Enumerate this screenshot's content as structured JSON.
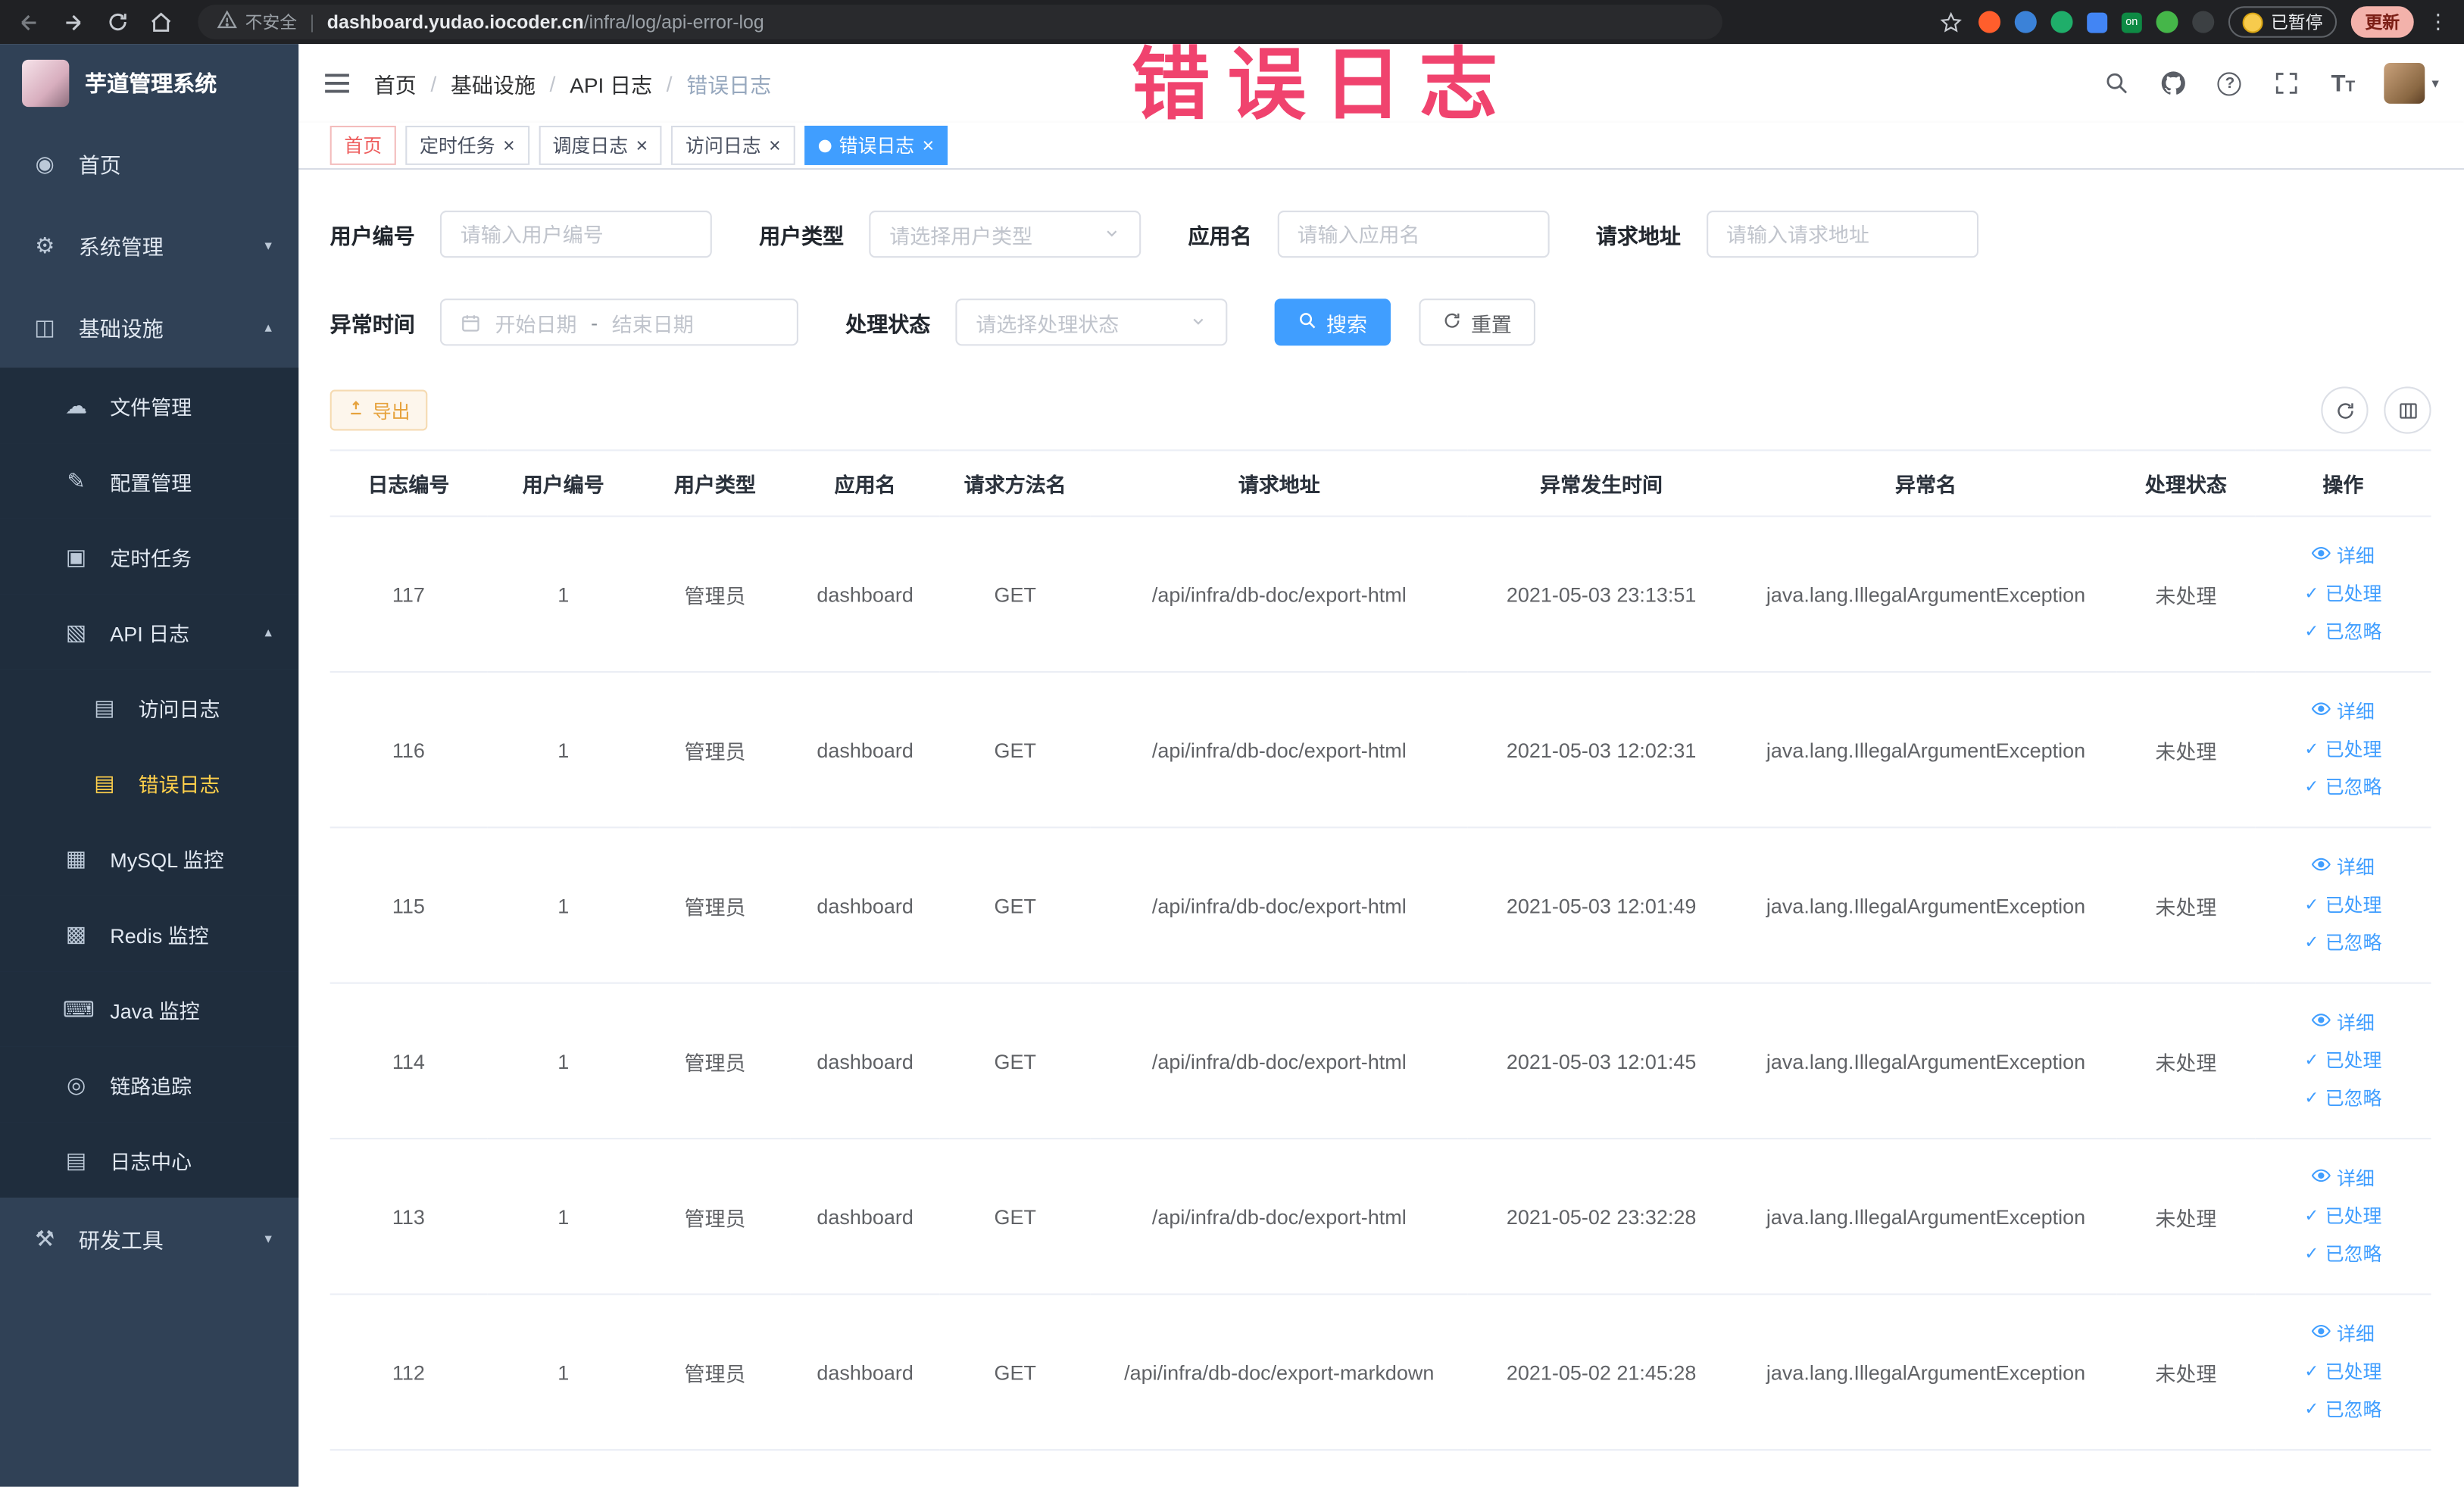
{
  "colors": {
    "accent": "#409eff",
    "sidebar_bg": "#304156",
    "submenu_bg": "#1f2d3d",
    "menu_active": "#ffd04b",
    "warning": "#e6a23c",
    "annotation": "#f0436e",
    "tag_home": "#ee5d5d"
  },
  "annotation": {
    "text": "错误日志"
  },
  "browser": {
    "security_label": "不安全",
    "url_domain": "dashboard.yudao.iocoder.cn",
    "url_path": "/infra/log/api-error-log",
    "on_badge": "on",
    "paused_label": "已暂停",
    "update_label": "更新"
  },
  "sidebar": {
    "logo_title": "芋道管理系统",
    "items": [
      {
        "name": "home",
        "label": "首页",
        "icon": "dashboard-icon",
        "glyph": "◉",
        "level": 1
      },
      {
        "name": "system-management",
        "label": "系统管理",
        "icon": "gear-icon",
        "glyph": "⚙",
        "level": 1,
        "expandable": true,
        "expanded": false
      },
      {
        "name": "infrastructure",
        "label": "基础设施",
        "icon": "component-icon",
        "glyph": "◫",
        "level": 1,
        "expandable": true,
        "expanded": true
      },
      {
        "name": "file-management",
        "label": "文件管理",
        "icon": "cloud-icon",
        "glyph": "☁",
        "level": 2
      },
      {
        "name": "config-management",
        "label": "配置管理",
        "icon": "edit-icon",
        "glyph": "✎",
        "level": 2
      },
      {
        "name": "scheduled-tasks",
        "label": "定时任务",
        "icon": "task-icon",
        "glyph": "▣",
        "level": 2
      },
      {
        "name": "api-logs",
        "label": "API 日志",
        "icon": "log-icon",
        "glyph": "▧",
        "level": 2,
        "expandable": true,
        "expanded": true
      },
      {
        "name": "access-log",
        "label": "访问日志",
        "icon": "document-icon",
        "glyph": "▤",
        "level": 3
      },
      {
        "name": "error-log",
        "label": "错误日志",
        "icon": "document-icon",
        "glyph": "▤",
        "level": 3,
        "active": true
      },
      {
        "name": "mysql-monitor",
        "label": "MySQL 监控",
        "icon": "database-icon",
        "glyph": "▦",
        "level": 2
      },
      {
        "name": "redis-monitor",
        "label": "Redis 监控",
        "icon": "layers-icon",
        "glyph": "▩",
        "level": 2
      },
      {
        "name": "java-monitor",
        "label": "Java 监控",
        "icon": "monitor-icon",
        "glyph": "⌨",
        "level": 2
      },
      {
        "name": "trace",
        "label": "链路追踪",
        "icon": "eye-icon",
        "glyph": "◎",
        "level": 2
      },
      {
        "name": "log-center",
        "label": "日志中心",
        "icon": "document-icon",
        "glyph": "▤",
        "level": 2
      },
      {
        "name": "dev-tools",
        "label": "研发工具",
        "icon": "tools-icon",
        "glyph": "⚒",
        "level": 1,
        "expandable": true,
        "expanded": false
      }
    ]
  },
  "breadcrumb": [
    "首页",
    "基础设施",
    "API 日志",
    "错误日志"
  ],
  "tabs": [
    {
      "name": "home",
      "label": "首页",
      "closable": false,
      "active": false,
      "home": true
    },
    {
      "name": "scheduled-tasks",
      "label": "定时任务",
      "closable": true,
      "active": false
    },
    {
      "name": "schedule-log",
      "label": "调度日志",
      "closable": true,
      "active": false
    },
    {
      "name": "access-log",
      "label": "访问日志",
      "closable": true,
      "active": false
    },
    {
      "name": "error-log",
      "label": "错误日志",
      "closable": true,
      "active": true
    }
  ],
  "filters": {
    "user_id": {
      "label": "用户编号",
      "placeholder": "请输入用户编号"
    },
    "user_type": {
      "label": "用户类型",
      "placeholder": "请选择用户类型"
    },
    "app_name": {
      "label": "应用名",
      "placeholder": "请输入应用名"
    },
    "request_url": {
      "label": "请求地址",
      "placeholder": "请输入请求地址"
    },
    "exception_time": {
      "label": "异常时间",
      "start_placeholder": "开始日期",
      "separator": "-",
      "end_placeholder": "结束日期"
    },
    "process_status": {
      "label": "处理状态",
      "placeholder": "请选择处理状态"
    },
    "search_label": "搜索",
    "reset_label": "重置"
  },
  "toolbar": {
    "export_label": "导出"
  },
  "table": {
    "columns": [
      "日志编号",
      "用户编号",
      "用户类型",
      "应用名",
      "请求方法名",
      "请求地址",
      "异常发生时间",
      "异常名",
      "处理状态",
      "操作"
    ],
    "field_order": [
      "id",
      "user_id",
      "user_type",
      "app",
      "method",
      "url",
      "time",
      "exception",
      "status"
    ],
    "actions": {
      "detail": "详细",
      "processed": "已处理",
      "ignored": "已忽略"
    },
    "rows": [
      {
        "id": "117",
        "user_id": "1",
        "user_type": "管理员",
        "app": "dashboard",
        "method": "GET",
        "url": "/api/infra/db-doc/export-html",
        "time": "2021-05-03 23:13:51",
        "exception": "java.lang.IllegalArgumentException",
        "status": "未处理"
      },
      {
        "id": "116",
        "user_id": "1",
        "user_type": "管理员",
        "app": "dashboard",
        "method": "GET",
        "url": "/api/infra/db-doc/export-html",
        "time": "2021-05-03 12:02:31",
        "exception": "java.lang.IllegalArgumentException",
        "status": "未处理"
      },
      {
        "id": "115",
        "user_id": "1",
        "user_type": "管理员",
        "app": "dashboard",
        "method": "GET",
        "url": "/api/infra/db-doc/export-html",
        "time": "2021-05-03 12:01:49",
        "exception": "java.lang.IllegalArgumentException",
        "status": "未处理"
      },
      {
        "id": "114",
        "user_id": "1",
        "user_type": "管理员",
        "app": "dashboard",
        "method": "GET",
        "url": "/api/infra/db-doc/export-html",
        "time": "2021-05-03 12:01:45",
        "exception": "java.lang.IllegalArgumentException",
        "status": "未处理"
      },
      {
        "id": "113",
        "user_id": "1",
        "user_type": "管理员",
        "app": "dashboard",
        "method": "GET",
        "url": "/api/infra/db-doc/export-html",
        "time": "2021-05-02 23:32:28",
        "exception": "java.lang.IllegalArgumentException",
        "status": "未处理"
      },
      {
        "id": "112",
        "user_id": "1",
        "user_type": "管理员",
        "app": "dashboard",
        "method": "GET",
        "url": "/api/infra/db-doc/export-markdown",
        "time": "2021-05-02 21:45:28",
        "exception": "java.lang.IllegalArgumentException",
        "status": "未处理"
      }
    ]
  }
}
